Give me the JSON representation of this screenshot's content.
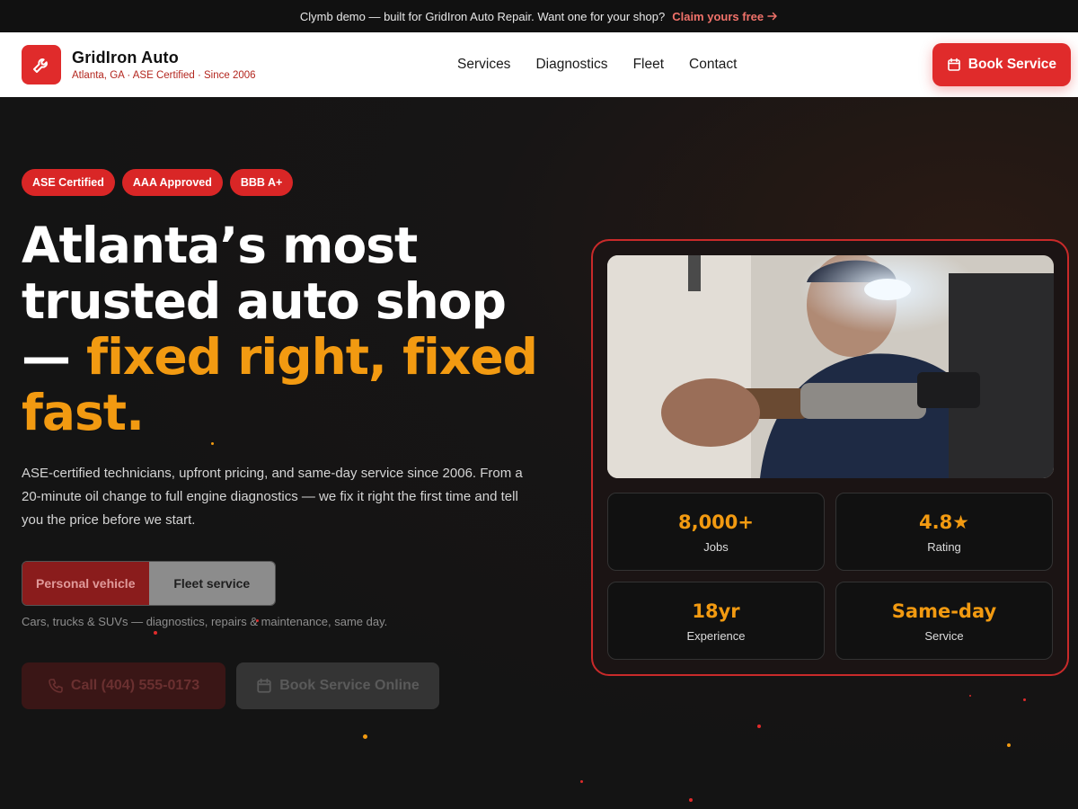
{
  "announcement": {
    "text": "Clymb demo — built for GridIron Auto Repair. Want one for your shop?",
    "link_label": "Claim yours free"
  },
  "header": {
    "brand_name": "GridIron Auto",
    "brand_tagline": "Atlanta, GA · ASE Certified · Since 2006",
    "nav": [
      "Services",
      "Diagnostics",
      "Fleet",
      "Contact"
    ],
    "book_label": "Book Service"
  },
  "hero": {
    "badges": [
      "ASE Certified",
      "AAA Approved",
      "BBB A+"
    ],
    "headline_line1": "Atlanta’s most",
    "headline_line2": "trusted auto shop",
    "headline_dash": "— ",
    "headline_accent1": "fixed right, fixed",
    "headline_accent2": "fast.",
    "lede": "ASE-certified technicians, upfront pricing, and same-day service since 2006. From a 20-minute oil change to full engine diagnostics — we fix it right the first time and tell you the price before we start.",
    "toggle": [
      "Personal vehicle",
      "Fleet service"
    ],
    "toggle_note": "Cars, trucks & SUVs — diagnostics, repairs & maintenance, same day.",
    "call_label": "Call (404) 555-0173",
    "book_online_label": "Book Service Online"
  },
  "stats": [
    {
      "value": "8,000+",
      "label": "Jobs"
    },
    {
      "value": "4.8★",
      "label": "Rating"
    },
    {
      "value": "18yr",
      "label": "Experience"
    },
    {
      "value": "Same-day",
      "label": "Service"
    }
  ],
  "colors": {
    "accent_red": "#e02b2b",
    "accent_orange": "#f29a11",
    "background": "#141414"
  },
  "icons": {
    "logo": "wrench-icon",
    "book": "calendar-icon",
    "call": "phone-icon",
    "announcement_link": "arrow-right-icon"
  }
}
